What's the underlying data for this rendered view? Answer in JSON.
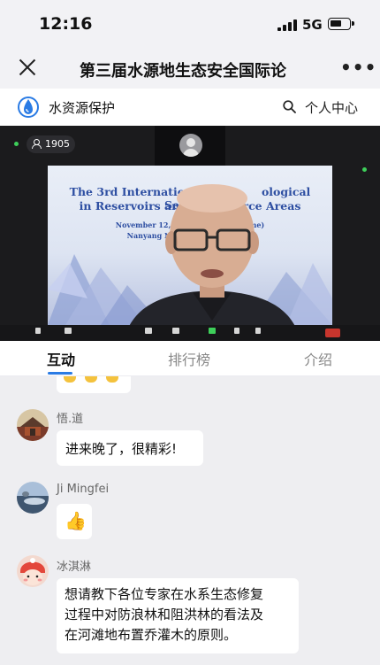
{
  "status_bar": {
    "time": "12:16",
    "network": "5G"
  },
  "header": {
    "title": "第三届水源地生态安全国际论",
    "close_icon": "close-icon",
    "more": "•••"
  },
  "brand": {
    "name": "水资源保护",
    "logo_icon": "water-drop-logo",
    "personal_center": "个人中心",
    "search_icon": "search-icon"
  },
  "live": {
    "viewer_count": "1905",
    "slide": {
      "line1": "The 3rd International For   ological Security",
      "line2": "in Reservoirs and     rce Areas",
      "date": "November 12, 2022 (      Time)",
      "venue": "Nanyang Norma        n"
    }
  },
  "tabs": [
    {
      "label": "互动",
      "active": true
    },
    {
      "label": "排行榜",
      "active": false
    },
    {
      "label": "介绍",
      "active": false
    }
  ],
  "messages": [
    {
      "name": "悟.道",
      "text": "进来晚了，很精彩!"
    },
    {
      "name": "Ji Mingfei",
      "emoji": "👍"
    },
    {
      "name": "冰淇淋",
      "lines": [
        "想请教下各位专家在水系生态修复",
        "过程中对防浪林和阻洪林的看法及",
        "在河滩地布置乔灌木的原则。"
      ]
    }
  ],
  "colors": {
    "accent": "#2a7be4",
    "live_bg": "#1b1b1d",
    "slide_text": "#2e4fa2",
    "leave_button": "#c7352d"
  }
}
